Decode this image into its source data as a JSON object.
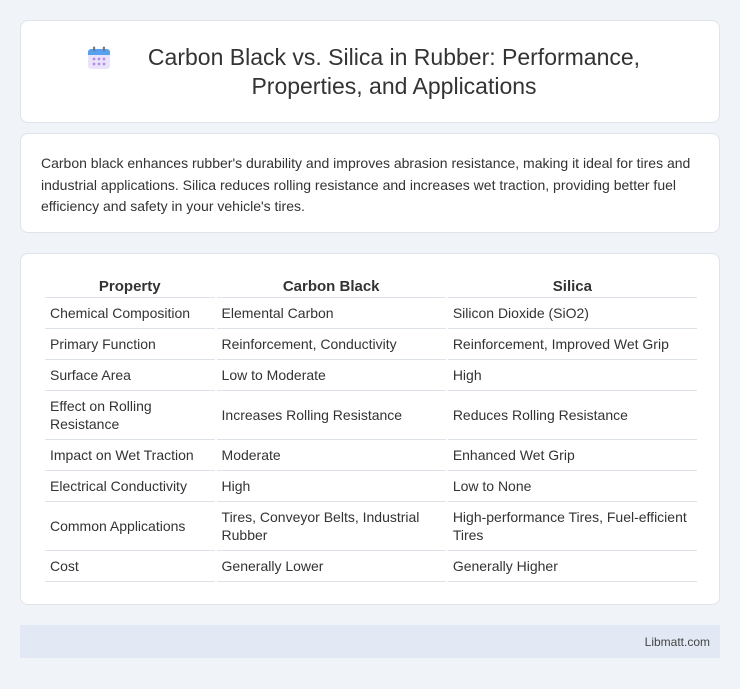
{
  "header": {
    "title": "Carbon Black vs. Silica in Rubber: Performance, Properties, and Applications",
    "icon": "calendar-icon"
  },
  "intro": {
    "text": "Carbon black enhances rubber's durability and improves abrasion resistance, making it ideal for tires and industrial applications. Silica reduces rolling resistance and increases wet traction, providing better fuel efficiency and safety in your vehicle's tires."
  },
  "table": {
    "headers": [
      "Property",
      "Carbon Black",
      "Silica"
    ],
    "rows": [
      [
        "Chemical Composition",
        "Elemental Carbon",
        "Silicon Dioxide (SiO2)"
      ],
      [
        "Primary Function",
        "Reinforcement, Conductivity",
        "Reinforcement, Improved Wet Grip"
      ],
      [
        "Surface Area",
        "Low to Moderate",
        "High"
      ],
      [
        "Effect on Rolling Resistance",
        "Increases Rolling Resistance",
        "Reduces Rolling Resistance"
      ],
      [
        "Impact on Wet Traction",
        "Moderate",
        "Enhanced Wet Grip"
      ],
      [
        "Electrical Conductivity",
        "High",
        "Low to None"
      ],
      [
        "Common Applications",
        "Tires, Conveyor Belts, Industrial Rubber",
        "High-performance Tires, Fuel-efficient Tires"
      ],
      [
        "Cost",
        "Generally Lower",
        "Generally Higher"
      ]
    ]
  },
  "footer": {
    "text": "Libmatt.com"
  }
}
